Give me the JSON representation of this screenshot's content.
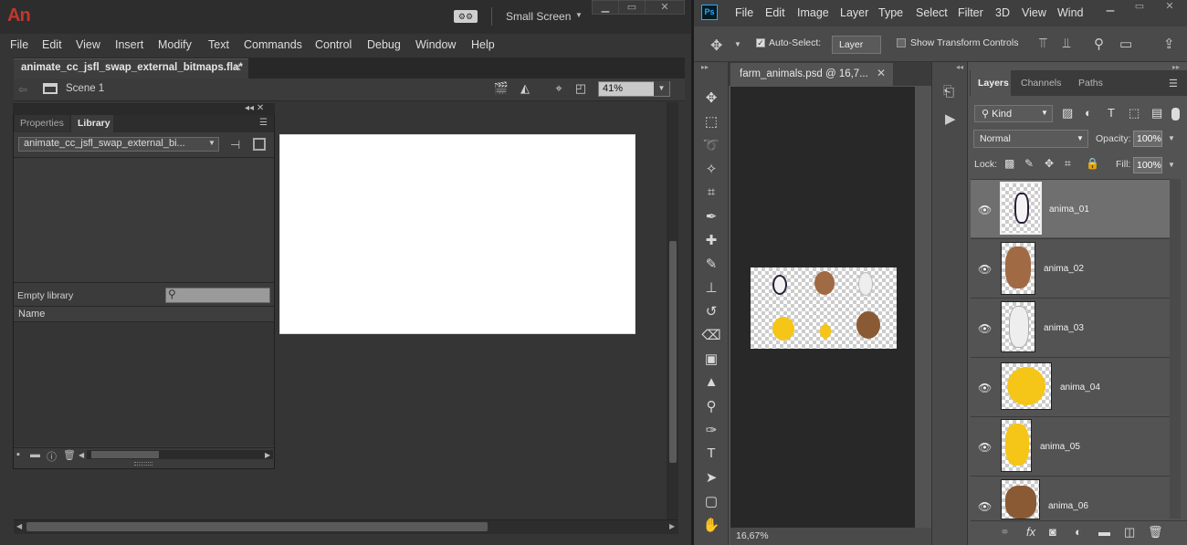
{
  "animate": {
    "logo": "An",
    "workspace": "Small Screen",
    "menu": [
      "File",
      "Edit",
      "View",
      "Insert",
      "Modify",
      "Text",
      "Commands",
      "Control",
      "Debug",
      "Window",
      "Help"
    ],
    "doc_tab": "animate_cc_jsfl_swap_external_bitmaps.fla*",
    "scene": "Scene 1",
    "zoom": "41%",
    "library": {
      "tab_properties": "Properties",
      "tab_library": "Library",
      "document_select": "animate_cc_jsfl_swap_external_bi...",
      "status": "Empty library",
      "column_name": "Name"
    }
  },
  "photoshop": {
    "logo": "Ps",
    "menu": [
      "File",
      "Edit",
      "Image",
      "Layer",
      "Type",
      "Select",
      "Filter",
      "3D",
      "View",
      "Wind"
    ],
    "options": {
      "auto_select": "Auto-Select:",
      "auto_select_target": "Layer",
      "show_transform": "Show Transform Controls"
    },
    "doc_tab": "farm_animals.psd @ 16,7...",
    "zoom_status": "16,67%",
    "layers_panel": {
      "tabs": [
        "Layers",
        "Channels",
        "Paths"
      ],
      "filter_kind": "Kind",
      "blend_mode": "Normal",
      "opacity_label": "Opacity:",
      "opacity_value": "100%",
      "lock_label": "Lock:",
      "fill_label": "Fill:",
      "fill_value": "100%",
      "layers": [
        {
          "name": "anima_01",
          "selected": true
        },
        {
          "name": "anima_02",
          "selected": false
        },
        {
          "name": "anima_03",
          "selected": false
        },
        {
          "name": "anima_04",
          "selected": false
        },
        {
          "name": "anima_05",
          "selected": false
        },
        {
          "name": "anima_06",
          "selected": false
        }
      ]
    }
  },
  "colors": {
    "animate_brand": "#c1372f",
    "photoshop_brand": "#31a8ff",
    "stage": "#ffffff"
  }
}
